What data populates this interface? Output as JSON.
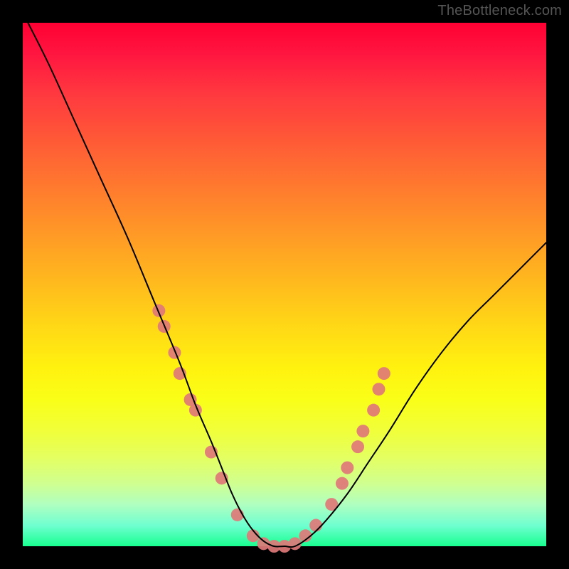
{
  "watermark": "TheBottleneck.com",
  "chart_data": {
    "type": "line",
    "title": "",
    "xlabel": "",
    "ylabel": "",
    "xlim": [
      0,
      100
    ],
    "ylim": [
      0,
      100
    ],
    "background_gradient": {
      "top": "#ff0033",
      "mid": "#ffe000",
      "bottom": "#18ff90"
    },
    "series": [
      {
        "name": "bottleneck-curve",
        "color": "#000000",
        "stroke_width": 2,
        "x": [
          1,
          5,
          10,
          15,
          20,
          25,
          30,
          33,
          36,
          38,
          40,
          42,
          44,
          46,
          48,
          50,
          52,
          55,
          58,
          62,
          66,
          70,
          75,
          80,
          85,
          90,
          95,
          100
        ],
        "values": [
          100,
          92,
          81,
          70,
          59,
          47,
          35,
          27,
          20,
          15,
          10,
          6,
          3,
          1,
          0,
          0,
          0,
          2,
          5,
          10,
          16,
          22,
          30,
          37,
          43,
          48,
          53,
          58
        ]
      }
    ],
    "markers": {
      "name": "highlight-dots",
      "color": "#e07878",
      "radius": 9,
      "points": [
        {
          "x": 26,
          "y": 45
        },
        {
          "x": 27,
          "y": 42
        },
        {
          "x": 29,
          "y": 37
        },
        {
          "x": 30,
          "y": 33
        },
        {
          "x": 32,
          "y": 28
        },
        {
          "x": 33,
          "y": 26
        },
        {
          "x": 36,
          "y": 18
        },
        {
          "x": 38,
          "y": 13
        },
        {
          "x": 41,
          "y": 6
        },
        {
          "x": 44,
          "y": 2
        },
        {
          "x": 46,
          "y": 0.5
        },
        {
          "x": 48,
          "y": 0
        },
        {
          "x": 50,
          "y": 0
        },
        {
          "x": 52,
          "y": 0.5
        },
        {
          "x": 54,
          "y": 2
        },
        {
          "x": 56,
          "y": 4
        },
        {
          "x": 59,
          "y": 8
        },
        {
          "x": 61,
          "y": 12
        },
        {
          "x": 62,
          "y": 15
        },
        {
          "x": 64,
          "y": 19
        },
        {
          "x": 65,
          "y": 22
        },
        {
          "x": 67,
          "y": 26
        },
        {
          "x": 68,
          "y": 30
        },
        {
          "x": 69,
          "y": 33
        }
      ]
    }
  }
}
